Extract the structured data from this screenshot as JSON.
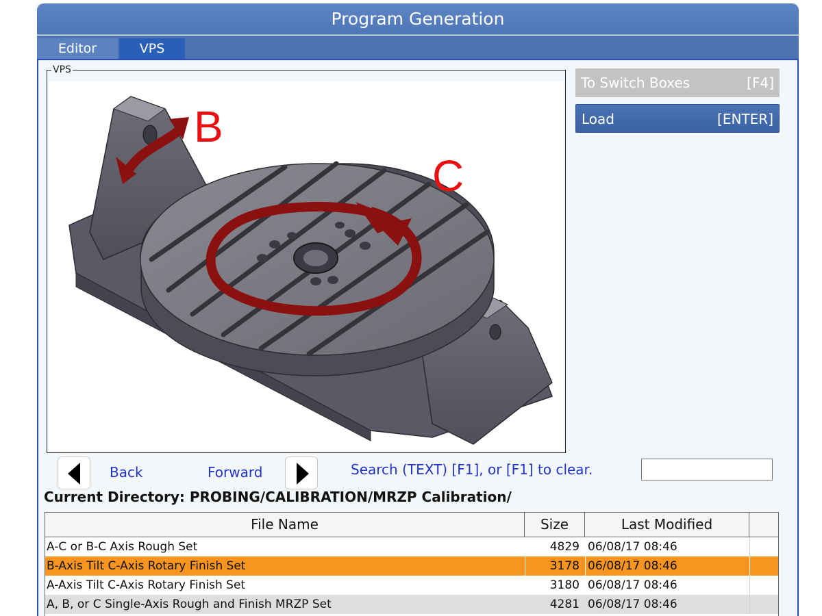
{
  "window": {
    "title": "Program Generation"
  },
  "tabs": [
    {
      "label": "Editor",
      "active": false
    },
    {
      "label": "VPS",
      "active": true
    }
  ],
  "vps_panel": {
    "legend": "VPS",
    "image_labels": {
      "b": "B",
      "c": "C"
    }
  },
  "buttons": {
    "switch_boxes": {
      "label": "To Switch Boxes",
      "key": "[F4]",
      "enabled": false
    },
    "load": {
      "label": "Load",
      "key": "[ENTER]",
      "enabled": true
    }
  },
  "navigation": {
    "back_label": "Back",
    "forward_label": "Forward",
    "search_hint": "Search (TEXT) [F1], or [F1] to clear.",
    "search_value": ""
  },
  "current_directory": "Current Directory: PROBING/CALIBRATION/MRZP Calibration/",
  "file_table": {
    "columns": [
      "File Name",
      "Size",
      "Last Modified",
      ""
    ],
    "rows": [
      {
        "name": "A-C or B-C Axis Rough Set",
        "size": "4829",
        "modified": "06/08/17 08:46",
        "selected": false
      },
      {
        "name": "B-Axis Tilt C-Axis Rotary Finish Set",
        "size": "3178",
        "modified": "06/08/17 08:46",
        "selected": true
      },
      {
        "name": "A-Axis Tilt C-Axis Rotary Finish Set",
        "size": "3180",
        "modified": "06/08/17 08:46",
        "selected": false
      },
      {
        "name": "A, B, or C Single-Axis Rough and Finish MRZP Set",
        "size": "4281",
        "modified": "06/08/17 08:46",
        "selected": false
      }
    ]
  },
  "colors": {
    "title_bar": "#5d84c4",
    "active_tab": "#2a5fb8",
    "selected_row": "#f79520",
    "link_text": "#2033c8",
    "rotation_arrow": "#8b1010",
    "axis_label": "#e81010"
  }
}
